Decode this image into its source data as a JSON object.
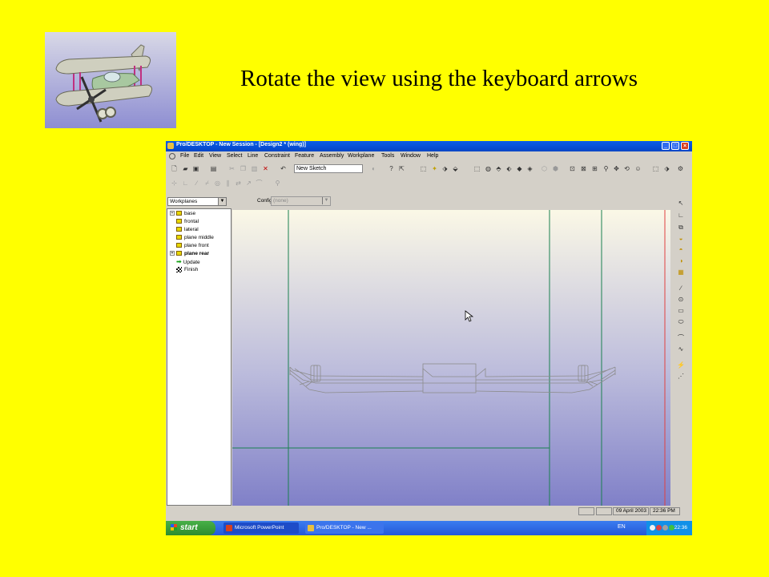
{
  "slide": {
    "title": "Rotate the view using the keyboard arrows"
  },
  "window": {
    "title": "Pro/DESKTOP - New Session - [Design2 * (wing)]",
    "min": "_",
    "max": "□",
    "close": "×"
  },
  "menu": [
    "File",
    "Edit",
    "View",
    "Select",
    "Line",
    "Constraint",
    "Feature",
    "Assembly",
    "Workplane",
    "Tools",
    "Window",
    "Help"
  ],
  "toolbar": {
    "sketch_combo": "New Sketch"
  },
  "panel": {
    "selector": "Workplanes",
    "config_label": "Configuration:",
    "config_value": "(none)"
  },
  "tree": [
    {
      "label": "base",
      "expandable": true,
      "kind": "workplane"
    },
    {
      "label": "frontal",
      "expandable": false,
      "kind": "workplane"
    },
    {
      "label": "lateral",
      "expandable": false,
      "kind": "workplane"
    },
    {
      "label": "plane middle",
      "expandable": false,
      "kind": "workplane"
    },
    {
      "label": "plane front",
      "expandable": false,
      "kind": "workplane"
    },
    {
      "label": "plane rear",
      "expandable": true,
      "kind": "workplane",
      "bold": true
    },
    {
      "label": "Update",
      "expandable": false,
      "kind": "arrow"
    },
    {
      "label": "Finish",
      "expandable": false,
      "kind": "flag"
    }
  ],
  "status": {
    "date": "09 April 2003",
    "time": "22:36 PM"
  },
  "taskbar": {
    "start": "start",
    "tasks": [
      "Microsoft PowerPoint",
      "Pro/DESKTOP - New ..."
    ],
    "lang": "EN",
    "clock": "22:36"
  },
  "colors": {
    "slide_bg": "#ffff00",
    "title_bar": "#0a5ee8",
    "construction_line": "#1a8050",
    "sketch_line": "#909090",
    "taskbar": "#2458d8"
  }
}
